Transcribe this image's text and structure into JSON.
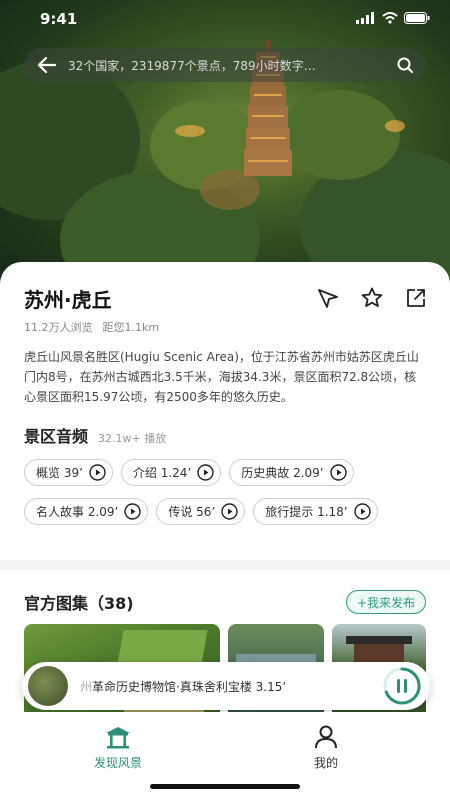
{
  "status": {
    "time": "9:41"
  },
  "search": {
    "placeholder": "32个国家，2319877个景点，789小时数字…"
  },
  "scenic": {
    "title": "苏州·虎丘",
    "views": "11.2万人浏览",
    "distance": "距您1.1km",
    "description": "虎丘山风景名胜区(Hugiu Scenic Area)，位于江苏省苏州市姑苏区虎丘山门内8号，在苏州古城西北3.5千米，海拔34.3米，景区面积72.8公顷，核心景区面积15.97公顷，有2500多年的悠久历史。"
  },
  "audio": {
    "heading": "景区音频",
    "plays": "32.1w+ 播放",
    "chips": [
      {
        "label": "概览 39’"
      },
      {
        "label": "介绍 1.24’"
      },
      {
        "label": "历史典故 2.09’"
      },
      {
        "label": "名人故事 2.09’"
      },
      {
        "label": "传说 56’"
      },
      {
        "label": "旅行提示 1.18’"
      }
    ]
  },
  "gallery": {
    "title": "官方图集（38)",
    "publish": "+我来发布"
  },
  "player": {
    "prefix": "州",
    "title": "革命历史博物馆·真珠舍利宝楼",
    "duration": "3.15’"
  },
  "tabs": [
    {
      "label": "发现风景"
    },
    {
      "label": "我的"
    }
  ],
  "colors": {
    "accent": "#2f8f78"
  }
}
